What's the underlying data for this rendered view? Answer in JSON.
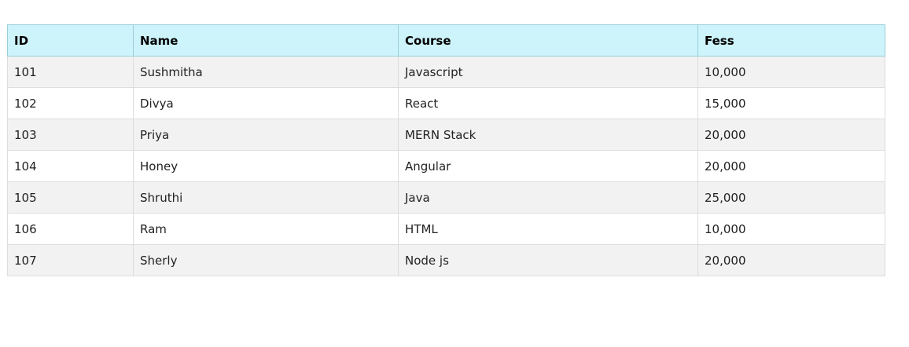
{
  "table": {
    "headers": [
      "ID",
      "Name",
      "Course",
      "Fess"
    ],
    "rows": [
      [
        "101",
        "Sushmitha",
        "Javascript",
        "10,000"
      ],
      [
        "102",
        "Divya",
        "React",
        "15,000"
      ],
      [
        "103",
        "Priya",
        "MERN Stack",
        "20,000"
      ],
      [
        "104",
        "Honey",
        "Angular",
        "20,000"
      ],
      [
        "105",
        "Shruthi",
        "Java",
        "25,000"
      ],
      [
        "106",
        "Ram",
        "HTML",
        "10,000"
      ],
      [
        "107",
        "Sherly",
        "Node js",
        "20,000"
      ]
    ]
  },
  "colors": {
    "header_bg": "#cdf3fb",
    "row_odd_bg": "#f2f2f2",
    "row_even_bg": "#ffffff"
  }
}
